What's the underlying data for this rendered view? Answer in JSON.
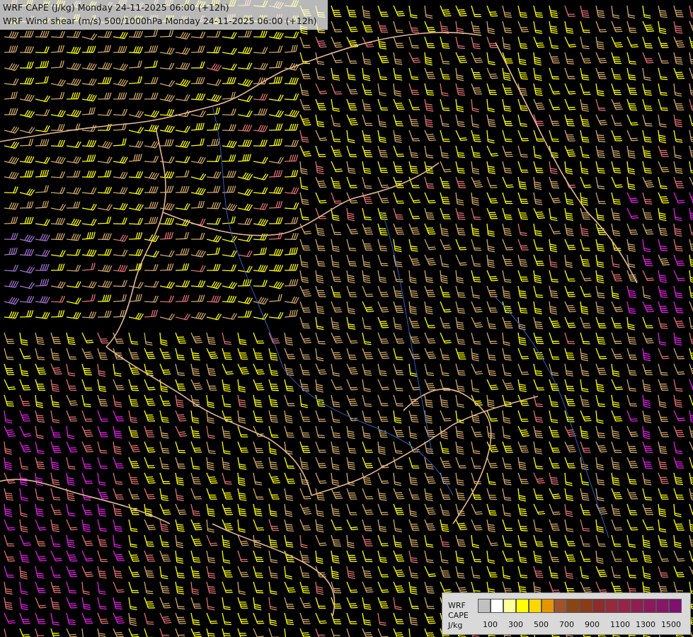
{
  "header": {
    "line1": "WRF CAPE (J/kg) Monday 24-11-2025 06:00 (+12h)",
    "line2": "WRF Wind shear (m/s) 500/1000hPa Monday 24-11-2025 06:00 (+12h)"
  },
  "legend": {
    "title_lines": [
      "WRF",
      "CAPE",
      "J/kg"
    ],
    "ticks": [
      "100",
      "300",
      "500",
      "700",
      "900",
      "1100",
      "1300",
      "1500"
    ],
    "swatches": [
      "#c0c0c0",
      "#ffffff",
      "#ffff99",
      "#ffff00",
      "#ffd700",
      "#e69500",
      "#a0522d",
      "#8b4513",
      "#8b3a1a",
      "#8e2b2b",
      "#952a3c",
      "#962448",
      "#8f1e52",
      "#8b1a5c",
      "#861666",
      "#800f70"
    ]
  },
  "colors": {
    "barb_yellow": "#ffff00",
    "barb_tan": "#d2a868",
    "barb_pink": "#e07070",
    "barb_magenta": "#e020e0",
    "barb_lilac": "#a070d0",
    "border": "#e8b890",
    "river": "#3060c0"
  }
}
